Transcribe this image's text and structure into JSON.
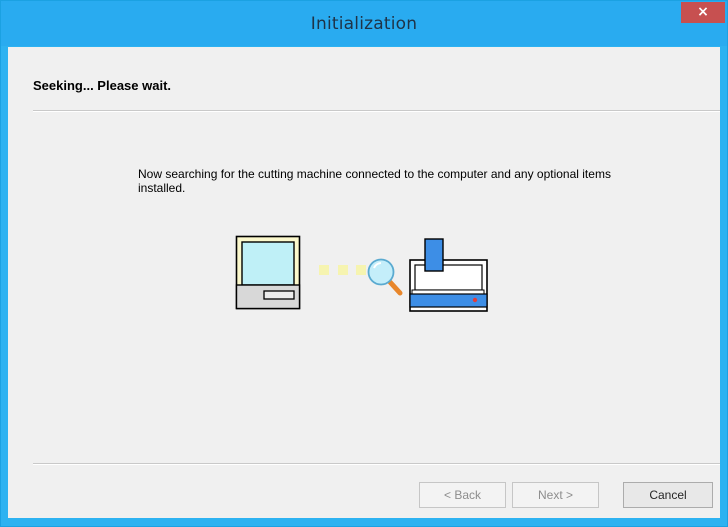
{
  "window": {
    "title": "Initialization",
    "close_glyph": "×"
  },
  "heading": "Seeking... Please wait.",
  "description": "Now searching for the cutting machine connected to the computer and any optional items installed.",
  "illustration": {
    "icons": [
      "computer-icon",
      "connection-dots-icon",
      "magnifier-icon",
      "cutting-machine-icon"
    ]
  },
  "buttons": {
    "back": "< Back",
    "next": "Next >",
    "cancel": "Cancel"
  },
  "colors": {
    "titlebar": "#29abf0",
    "close_button": "#c75050",
    "machine_blue": "#3d8ee6",
    "screen_cyan": "#bff0f7"
  }
}
